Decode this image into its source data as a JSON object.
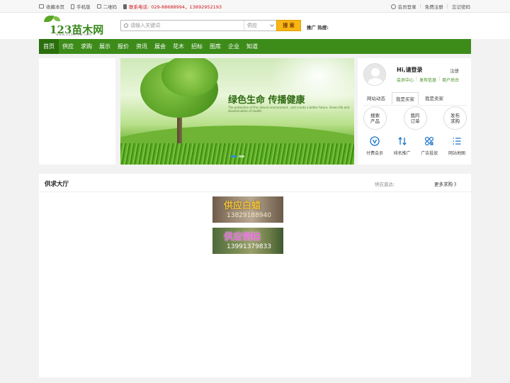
{
  "topbar": {
    "bookmark": "收藏本页",
    "mobile": "手机版",
    "qrcode": "二维码",
    "phone_label": "联系电话:",
    "phone_numbers": "029-88688994，13892952193",
    "login": "会员登录",
    "register": "免费注册",
    "forgot": "忘记密码",
    "sep": "|"
  },
  "logo": {
    "name": "123苗木网",
    "domain": "www.123mmw.com"
  },
  "search": {
    "placeholder": "请输入关键词",
    "type": "供应",
    "button": "搜 索",
    "hot_label": "推广 热搜:"
  },
  "nav": {
    "items": [
      "首页",
      "供应",
      "求购",
      "展示",
      "报价",
      "资讯",
      "展会",
      "花木",
      "招标",
      "图库",
      "企业",
      "知道"
    ]
  },
  "banner": {
    "slogan": "绿色生命 传播健康",
    "sub": "The protection of the natural environment , and create a better future. Green life and dissemination of health."
  },
  "user": {
    "greeting": "Hi,请登录",
    "register": "注册",
    "links": [
      "会员中心",
      "发布信息",
      "商户后台"
    ],
    "tabs": [
      "网站动态",
      "我是买家",
      "我是卖家"
    ],
    "circles": [
      "搜索\n产品",
      "我的\n订单",
      "发布\n求购"
    ],
    "icons": [
      "付费会员",
      "排名推广",
      "广告投放",
      "网站地图"
    ]
  },
  "section": {
    "title": "供求大厅",
    "direct": "供应直达:",
    "more": "更多求购 》",
    "ads": [
      {
        "title": "供应白蜡",
        "phone": "13829188940"
      },
      {
        "title": "供应侧柏",
        "phone": "13991379833"
      }
    ]
  },
  "colors": {
    "green": "#3d8c1a",
    "nav_active": "#2a6f0c",
    "search_btn": "#f8b514",
    "phone_red": "#d0181f"
  }
}
